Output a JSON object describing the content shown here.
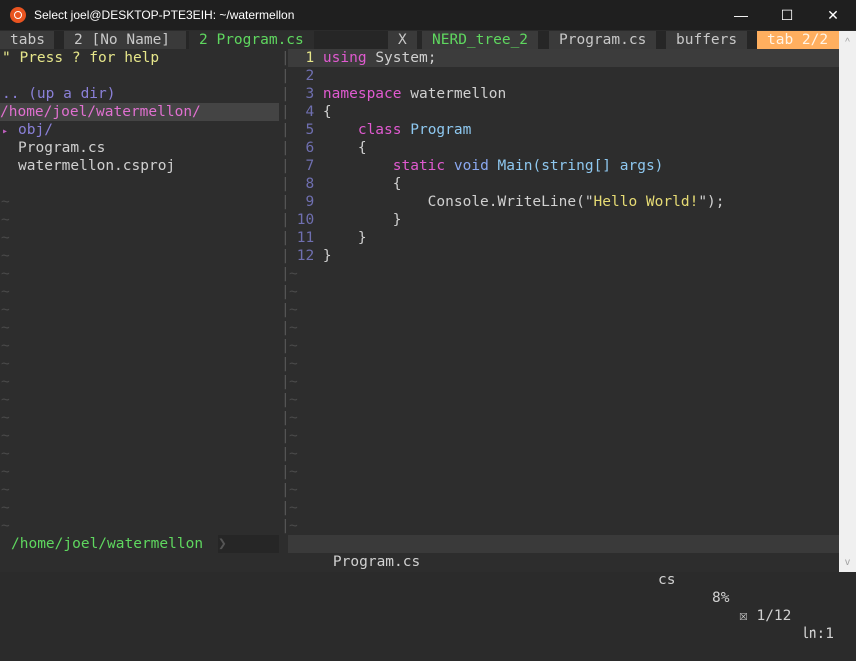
{
  "window": {
    "title": "Select joel@DESKTOP-PTE3EIH: ~/watermellon",
    "minimize": "—",
    "maximize": "☐",
    "close": "✕"
  },
  "tabline": {
    "tabs": [
      "tabs",
      "2 [No Name]",
      "2 Program.cs"
    ],
    "close": "X",
    "buffers": [
      "NERD_tree_2",
      "Program.cs"
    ],
    "buffers_label": "buffers",
    "tab_count": "tab 2/2",
    "colors": {
      "active": "#5fd75f",
      "badge": "#ffaf5f"
    }
  },
  "nerdtree": {
    "help": "\" Press ? for help",
    "up": ".. (up a dir)",
    "root": "/home/joel/watermellon/",
    "items": [
      {
        "marker": "▸",
        "name": "obj/"
      },
      {
        "marker": " ",
        "name": "Program.cs"
      },
      {
        "marker": " ",
        "name": "watermellon.csproj"
      }
    ]
  },
  "editor": {
    "lines": [
      [
        [
          "kw",
          "using"
        ],
        [
          "",
          "System;"
        ]
      ],
      [],
      [
        [
          "kw",
          "namespace"
        ],
        [
          "",
          "watermellon"
        ]
      ],
      [
        [
          "",
          "{"
        ]
      ],
      [
        [
          "",
          "    "
        ],
        [
          "kw",
          "class"
        ],
        [
          "cls",
          "Program"
        ]
      ],
      [
        [
          "",
          "    {"
        ]
      ],
      [
        [
          "",
          "        "
        ],
        [
          "kw",
          "static"
        ],
        [
          "ty",
          "void"
        ],
        [
          "cls",
          "Main(string[] args)"
        ]
      ],
      [
        [
          "",
          "        {"
        ]
      ],
      [
        [
          "",
          "            Console.WriteLine(\""
        ],
        [
          "str",
          "Hello World!"
        ],
        [
          "",
          "\");"
        ]
      ],
      [
        [
          "",
          "        }"
        ]
      ],
      [
        [
          "",
          "    }"
        ]
      ],
      [
        [
          "",
          "}"
        ]
      ]
    ]
  },
  "statusline": {
    "left_path": "/home/joel/watermellon",
    "file": "Program.cs",
    "filetype": "cs",
    "percent": "8%",
    "pos": "☒ 1/12",
    "col_label": "㏑:1"
  },
  "scrollbar": {
    "up": "^",
    "down": "v"
  }
}
